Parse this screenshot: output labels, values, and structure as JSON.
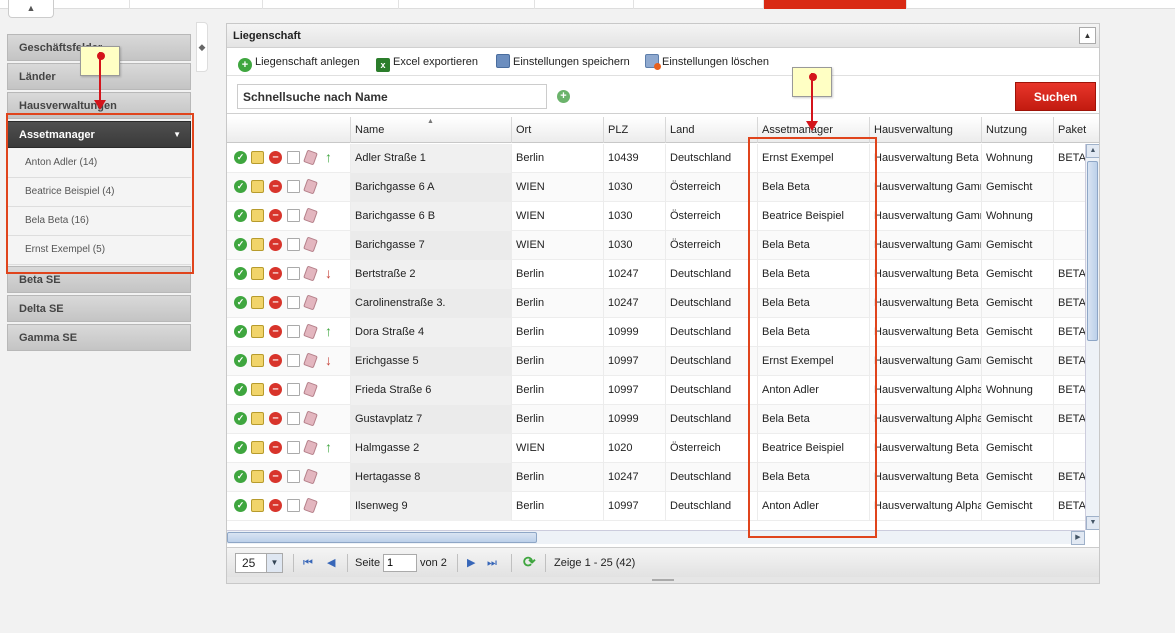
{
  "collapse_glyph": "▲",
  "sidebar": {
    "splitter_glyph": "◆",
    "items": [
      {
        "label": "Geschäftsfelder"
      },
      {
        "label": "Länder"
      },
      {
        "label": "Hausverwaltungen"
      },
      {
        "label": "Assetmanager",
        "active": true
      }
    ],
    "sub_items": [
      {
        "label": "Anton Adler (14)"
      },
      {
        "label": "Beatrice Beispiel (4)"
      },
      {
        "label": "Bela Beta (16)"
      },
      {
        "label": "Ernst Exempel (5)"
      }
    ],
    "items_after": [
      {
        "label": "Beta SE"
      },
      {
        "label": "Delta SE"
      },
      {
        "label": "Gamma SE"
      }
    ]
  },
  "panel": {
    "title": "Liegenschaft",
    "collapse_glyph": "▲",
    "toolbar": {
      "add_label": "Liegenschaft anlegen",
      "excel_label": "Excel exportieren",
      "save_settings_label": "Einstellungen speichern",
      "delete_settings_label": "Einstellungen löschen"
    },
    "search": {
      "placeholder": "Schnellsuche nach Name",
      "button_label": "Suchen"
    },
    "grid": {
      "columns": [
        "Name",
        "Ort",
        "PLZ",
        "Land",
        "Assetmanager",
        "Hausverwaltung",
        "Nutzung",
        "Paket"
      ],
      "rows": [
        {
          "name": "Adler Straße 1",
          "ort": "Berlin",
          "plz": "10439",
          "land": "Deutschland",
          "am": "Ernst Exempel",
          "hv": "Hausverwaltung Beta",
          "nutzung": "Wohnung",
          "paket": "BETA",
          "trend": "up"
        },
        {
          "name": "Barichgasse 6 A",
          "ort": "WIEN",
          "plz": "1030",
          "land": "Österreich",
          "am": "Bela Beta",
          "hv": "Hausverwaltung Gamma",
          "nutzung": "Gemischt",
          "paket": "",
          "trend": ""
        },
        {
          "name": "Barichgasse 6 B",
          "ort": "WIEN",
          "plz": "1030",
          "land": "Österreich",
          "am": "Beatrice Beispiel",
          "hv": "Hausverwaltung Gamma",
          "nutzung": "Wohnung",
          "paket": "",
          "trend": ""
        },
        {
          "name": "Barichgasse 7",
          "ort": "WIEN",
          "plz": "1030",
          "land": "Österreich",
          "am": "Bela Beta",
          "hv": "Hausverwaltung Gamma",
          "nutzung": "Gemischt",
          "paket": "",
          "trend": ""
        },
        {
          "name": "Bertstraße 2",
          "ort": "Berlin",
          "plz": "10247",
          "land": "Deutschland",
          "am": "Bela Beta",
          "hv": "Hausverwaltung Beta",
          "nutzung": "Gemischt",
          "paket": "BETA",
          "trend": "down"
        },
        {
          "name": "Carolinenstraße 3.",
          "ort": "Berlin",
          "plz": "10247",
          "land": "Deutschland",
          "am": "Bela Beta",
          "hv": "Hausverwaltung Beta",
          "nutzung": "Gemischt",
          "paket": "BETA",
          "trend": ""
        },
        {
          "name": "Dora Straße 4",
          "ort": "Berlin",
          "plz": "10999",
          "land": "Deutschland",
          "am": "Bela Beta",
          "hv": "Hausverwaltung Beta",
          "nutzung": "Gemischt",
          "paket": "BETA",
          "trend": "up"
        },
        {
          "name": "Erichgasse 5",
          "ort": "Berlin",
          "plz": "10997",
          "land": "Deutschland",
          "am": "Ernst Exempel",
          "hv": "Hausverwaltung Gamma",
          "nutzung": "Gemischt",
          "paket": "BETA",
          "trend": "down"
        },
        {
          "name": "Frieda Straße 6",
          "ort": "Berlin",
          "plz": "10997",
          "land": "Deutschland",
          "am": "Anton Adler",
          "hv": "Hausverwaltung Alpha",
          "nutzung": "Wohnung",
          "paket": "BETA",
          "trend": ""
        },
        {
          "name": "Gustavplatz 7",
          "ort": "Berlin",
          "plz": "10999",
          "land": "Deutschland",
          "am": "Bela Beta",
          "hv": "Hausverwaltung Alpha",
          "nutzung": "Gemischt",
          "paket": "BETA",
          "trend": ""
        },
        {
          "name": "Halmgasse 2",
          "ort": "WIEN",
          "plz": "1020",
          "land": "Österreich",
          "am": "Beatrice Beispiel",
          "hv": "Hausverwaltung Beta",
          "nutzung": "Gemischt",
          "paket": "",
          "trend": "up"
        },
        {
          "name": "Hertagasse 8",
          "ort": "Berlin",
          "plz": "10247",
          "land": "Deutschland",
          "am": "Bela Beta",
          "hv": "Hausverwaltung Beta",
          "nutzung": "Gemischt",
          "paket": "BETA",
          "trend": ""
        },
        {
          "name": "Ilsenweg 9",
          "ort": "Berlin",
          "plz": "10997",
          "land": "Deutschland",
          "am": "Anton Adler",
          "hv": "Hausverwaltung Alpha",
          "nutzung": "Gemischt",
          "paket": "BETA",
          "trend": ""
        }
      ]
    },
    "pager": {
      "page_size": "25",
      "page_label": "Seite",
      "page_value": "1",
      "of_label": "von 2",
      "summary": "Zeige 1 - 25 (42)"
    }
  },
  "colors": {
    "accent_red": "#d92a14",
    "annotation_red": "#e0441c",
    "ok_green": "#3fa63f"
  }
}
